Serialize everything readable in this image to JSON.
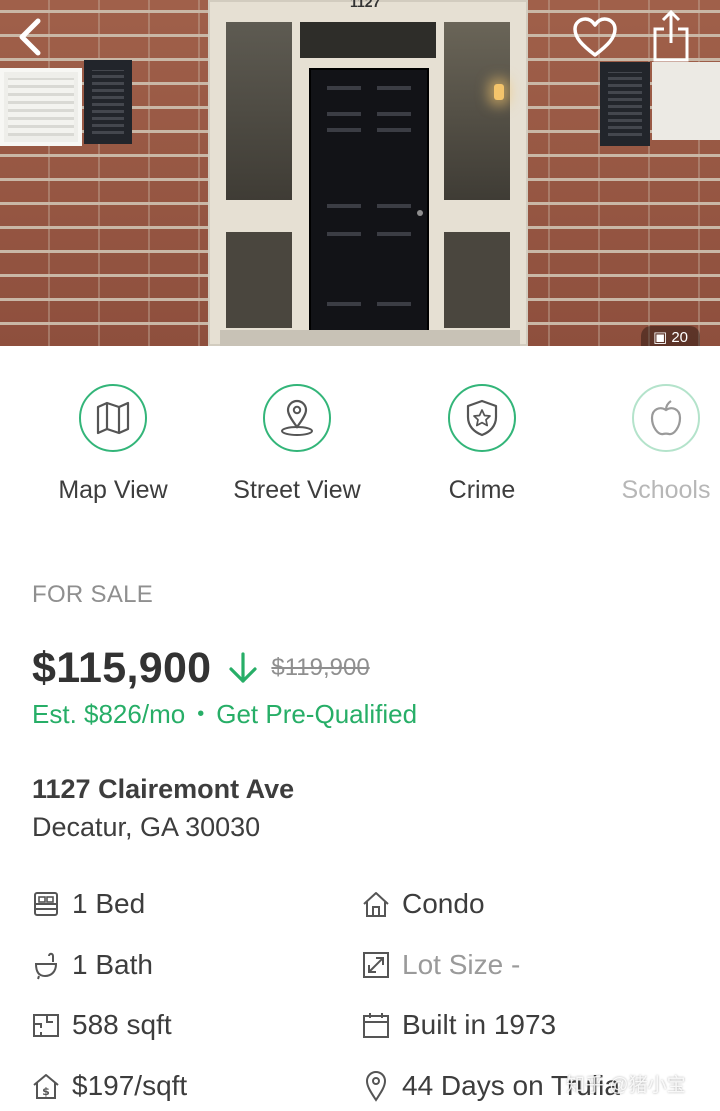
{
  "photo": {
    "house_number": "1127",
    "count": "20"
  },
  "quick_actions": [
    {
      "label": "Map View",
      "icon": "map-icon"
    },
    {
      "label": "Street View",
      "icon": "street-view-pin-icon"
    },
    {
      "label": "Crime",
      "icon": "shield-star-icon"
    },
    {
      "label": "Schools",
      "icon": "apple-icon"
    }
  ],
  "listing": {
    "status": "FOR SALE",
    "price": "$115,900",
    "previous_price": "$119,900",
    "estimate": "Est. $826/mo",
    "separator": "•",
    "prequalify": "Get Pre-Qualified",
    "street": "1127 Clairemont Ave",
    "city": "Decatur, GA 30030"
  },
  "facts": {
    "left": [
      {
        "text": "1 Bed",
        "icon": "bed-icon"
      },
      {
        "text": "1 Bath",
        "icon": "bath-icon"
      },
      {
        "text": "588 sqft",
        "icon": "floorplan-icon"
      },
      {
        "text": "$197/sqft",
        "icon": "house-dollar-icon"
      }
    ],
    "right": [
      {
        "text": "Condo",
        "icon": "house-icon"
      },
      {
        "text": "Lot Size -",
        "icon": "resize-icon"
      },
      {
        "text": "Built in 1973",
        "icon": "calendar-icon"
      },
      {
        "text": "44 Days on Trulia",
        "icon": "pin-icon"
      }
    ]
  },
  "watermark": "知乎 @猪小宝",
  "colors": {
    "accent": "#27ae67",
    "text": "#3d3d3d",
    "muted": "#8f8f8f"
  }
}
